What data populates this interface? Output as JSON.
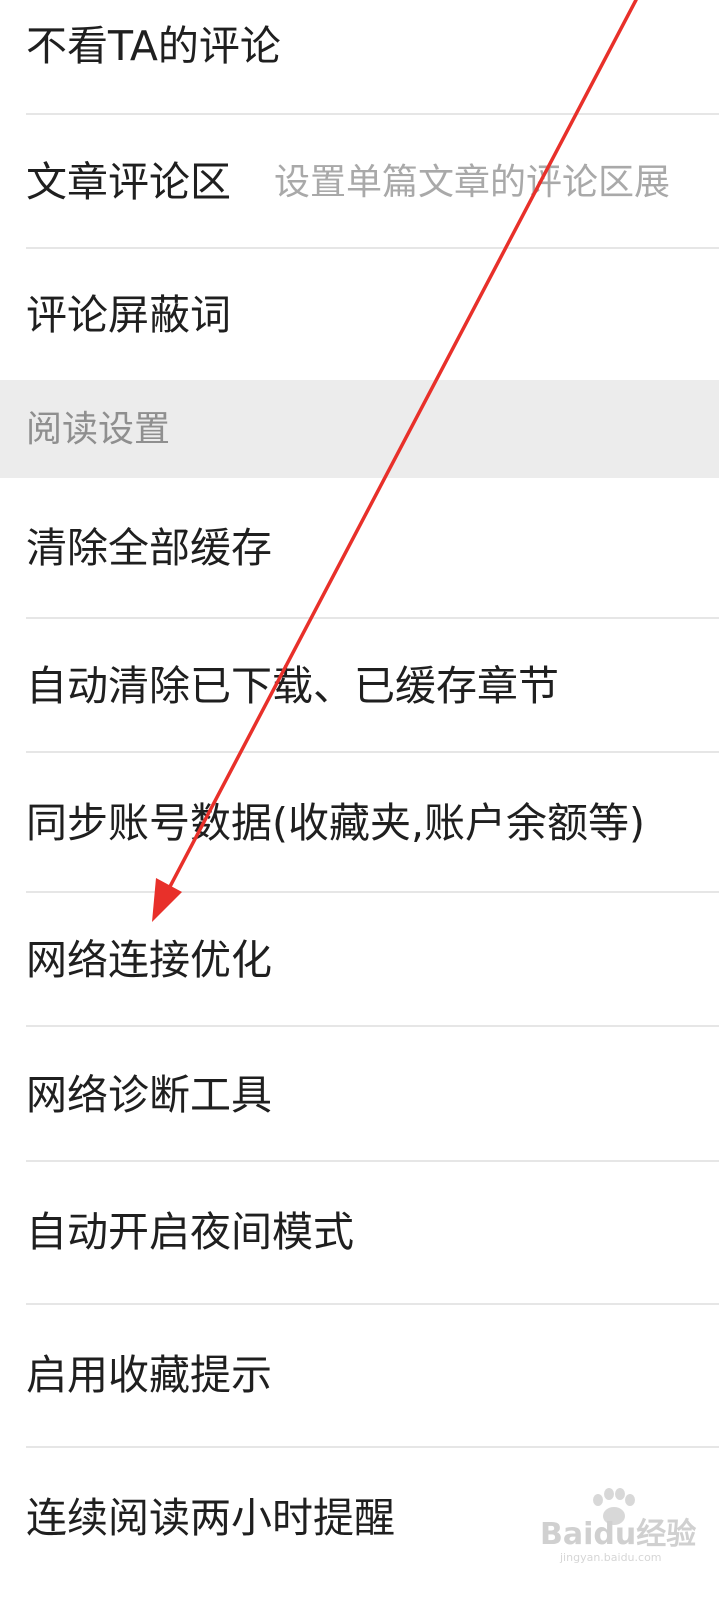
{
  "settings": {
    "items_top": [
      {
        "label": "不看TA的评论",
        "hint": ""
      },
      {
        "label": "文章评论区",
        "hint": "设置单篇文章的评论区展"
      },
      {
        "label": "评论屏蔽词",
        "hint": ""
      }
    ],
    "section_title": "阅读设置",
    "items_reading": [
      {
        "label": "清除全部缓存"
      },
      {
        "label": "自动清除已下载、已缓存章节"
      },
      {
        "label": "同步账号数据(收藏夹,账户余额等)"
      },
      {
        "label": "网络连接优化"
      },
      {
        "label": "网络诊断工具"
      },
      {
        "label": "自动开启夜间模式"
      },
      {
        "label": "启用收藏提示"
      },
      {
        "label": "连续阅读两小时提醒"
      }
    ]
  },
  "watermark": {
    "brand": "Baidu经验",
    "site": "jingyan.baidu.com"
  },
  "colors": {
    "text": "#1f1f1f",
    "hint": "#a9a9a9",
    "section_bg": "#ececec",
    "section_text": "#8f8f8f",
    "divider": "#e6e6e6",
    "annotation_arrow": "#e8302a"
  }
}
